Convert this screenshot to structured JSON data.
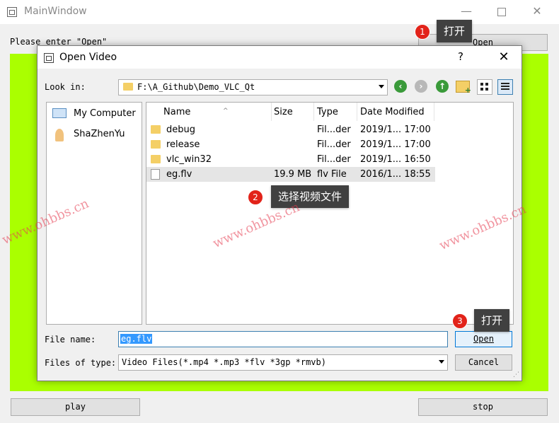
{
  "main_window": {
    "title": "MainWindow",
    "prompt": "Please enter \"Open\"",
    "open_button": "Open",
    "play_button": "play",
    "stop_button": "stop",
    "video_area_color": "#aaff00",
    "min_glyph": "—",
    "close_glyph": "✕"
  },
  "dialog": {
    "title": "Open Video",
    "help_glyph": "?",
    "close_glyph": "✕",
    "look_in_label": "Look in:",
    "look_in_path": "F:\\A_Github\\Demo_VLC_Qt",
    "nav": {
      "back_glyph": "‹",
      "forward_glyph": "›",
      "up_glyph": "↑"
    },
    "sidebar": [
      {
        "label": "My Computer",
        "icon": "computer-icon"
      },
      {
        "label": "ShaZhenYu",
        "icon": "user-icon"
      }
    ],
    "columns": [
      "Name",
      "Size",
      "Type",
      "Date Modified"
    ],
    "files": [
      {
        "name": "debug",
        "size": "",
        "type": "Fil...der",
        "date": "2019/1... 17:00",
        "kind": "folder"
      },
      {
        "name": "release",
        "size": "",
        "type": "Fil...der",
        "date": "2019/1... 17:00",
        "kind": "folder"
      },
      {
        "name": "vlc_win32",
        "size": "",
        "type": "Fil...der",
        "date": "2019/1... 16:50",
        "kind": "folder"
      },
      {
        "name": "eg.flv",
        "size": "19.9 MB",
        "type": "flv File",
        "date": "2016/1... 18:55",
        "kind": "file",
        "selected": true
      }
    ],
    "file_name_label": "File name:",
    "file_name_value": "eg.flv",
    "file_type_label": "Files of type:",
    "file_type_value": "Video Files(*.mp4 *.mp3 *flv *3gp *rmvb)",
    "open_button": "Open",
    "cancel_button": "Cancel",
    "grip_glyph": "⋰"
  },
  "callouts": [
    {
      "num": "1",
      "text": "打开"
    },
    {
      "num": "2",
      "text": "选择视频文件"
    },
    {
      "num": "3",
      "text": "打开"
    }
  ],
  "watermark": "www.ohbbs.cn",
  "colors": {
    "callout_bg": "#404040",
    "callout_badge": "#e2231a",
    "accent": "#0078d7"
  }
}
